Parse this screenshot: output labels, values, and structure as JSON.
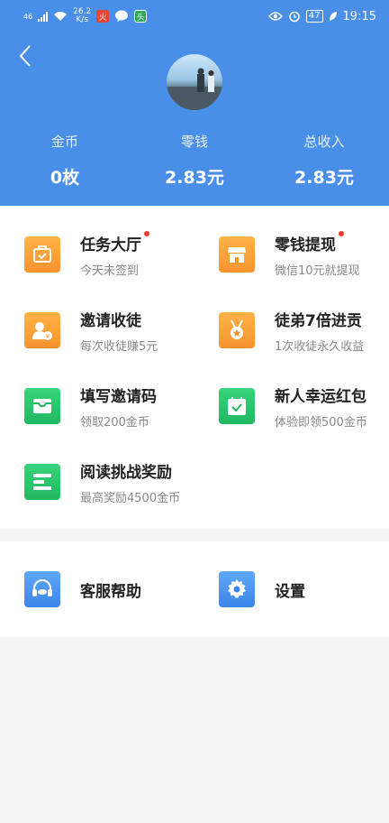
{
  "status_bar": {
    "signal": "46",
    "speed_value": "26.2",
    "speed_unit": "K/s",
    "battery": "47",
    "time": "19:15"
  },
  "header": {
    "stats": [
      {
        "label": "金币",
        "value": "0枚"
      },
      {
        "label": "零钱",
        "value": "2.83元"
      },
      {
        "label": "总收入",
        "value": "2.83元"
      }
    ]
  },
  "menu": {
    "items": [
      {
        "title": "任务大厅",
        "subtitle": "今天未签到",
        "icon": "task-icon",
        "dot": true
      },
      {
        "title": "零钱提现",
        "subtitle": "微信10元就提现",
        "icon": "store-icon",
        "dot": true
      },
      {
        "title": "邀请收徒",
        "subtitle": "每次收徒赚5元",
        "icon": "invite-user-icon",
        "dot": false
      },
      {
        "title": "徒弟7倍进贡",
        "subtitle": "1次收徒永久收益",
        "icon": "medal-icon",
        "dot": false
      },
      {
        "title": "填写邀请码",
        "subtitle": "领取200金币",
        "icon": "inbox-icon",
        "dot": false
      },
      {
        "title": "新人幸运红包",
        "subtitle": "体验即领500金币",
        "icon": "calendar-check-icon",
        "dot": false
      },
      {
        "title": "阅读挑战奖励",
        "subtitle": "最高奖励4500金币",
        "icon": "list-icon",
        "dot": false
      }
    ]
  },
  "menu2": {
    "items": [
      {
        "title": "客服帮助",
        "icon": "headset-icon"
      },
      {
        "title": "设置",
        "icon": "gear-icon"
      }
    ]
  },
  "colors": {
    "header_bg": "#4a8fe7",
    "orange": "#f7932f",
    "green": "#21b862",
    "blue": "#3b86ea",
    "red_dot": "#f03c2e"
  }
}
